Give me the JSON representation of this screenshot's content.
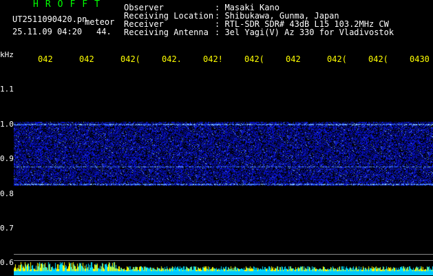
{
  "app": {
    "title": "HROFFT",
    "file_name": "UT2511090420.pn",
    "mode": "meteor",
    "datetime": "25.11.09 04:20",
    "level": "44."
  },
  "metadata": [
    {
      "label": "Observer",
      "value": "Masaki Kano"
    },
    {
      "label": "Receiving Location",
      "value": "Shibukawa, Gunma, Japan"
    },
    {
      "label": "Receiver",
      "value": "RTL-SDR SDR# 43dB L15 103.2MHz CW"
    },
    {
      "label": "Receiving Antenna",
      "value": "3el Yagi(V) Az 330 for Vladivostok"
    }
  ],
  "axis": {
    "unit": "kHz",
    "y_ticks": [
      "1.1",
      "1.0",
      "0.9",
      "0.8",
      "0.7",
      "0.6"
    ],
    "time_ticks": [
      "042",
      "042",
      "042(",
      "042.",
      "042!",
      "042(",
      "042",
      "042(",
      "042(",
      "0430"
    ]
  },
  "colors": {
    "background": "#000000",
    "title": "#00ff00",
    "text": "#ffffff",
    "time_ticks": "#ffff00",
    "noise": "#1e2cff",
    "bottom_bar": "#00c8ff",
    "bottom_spikes": "#ffff00"
  }
}
